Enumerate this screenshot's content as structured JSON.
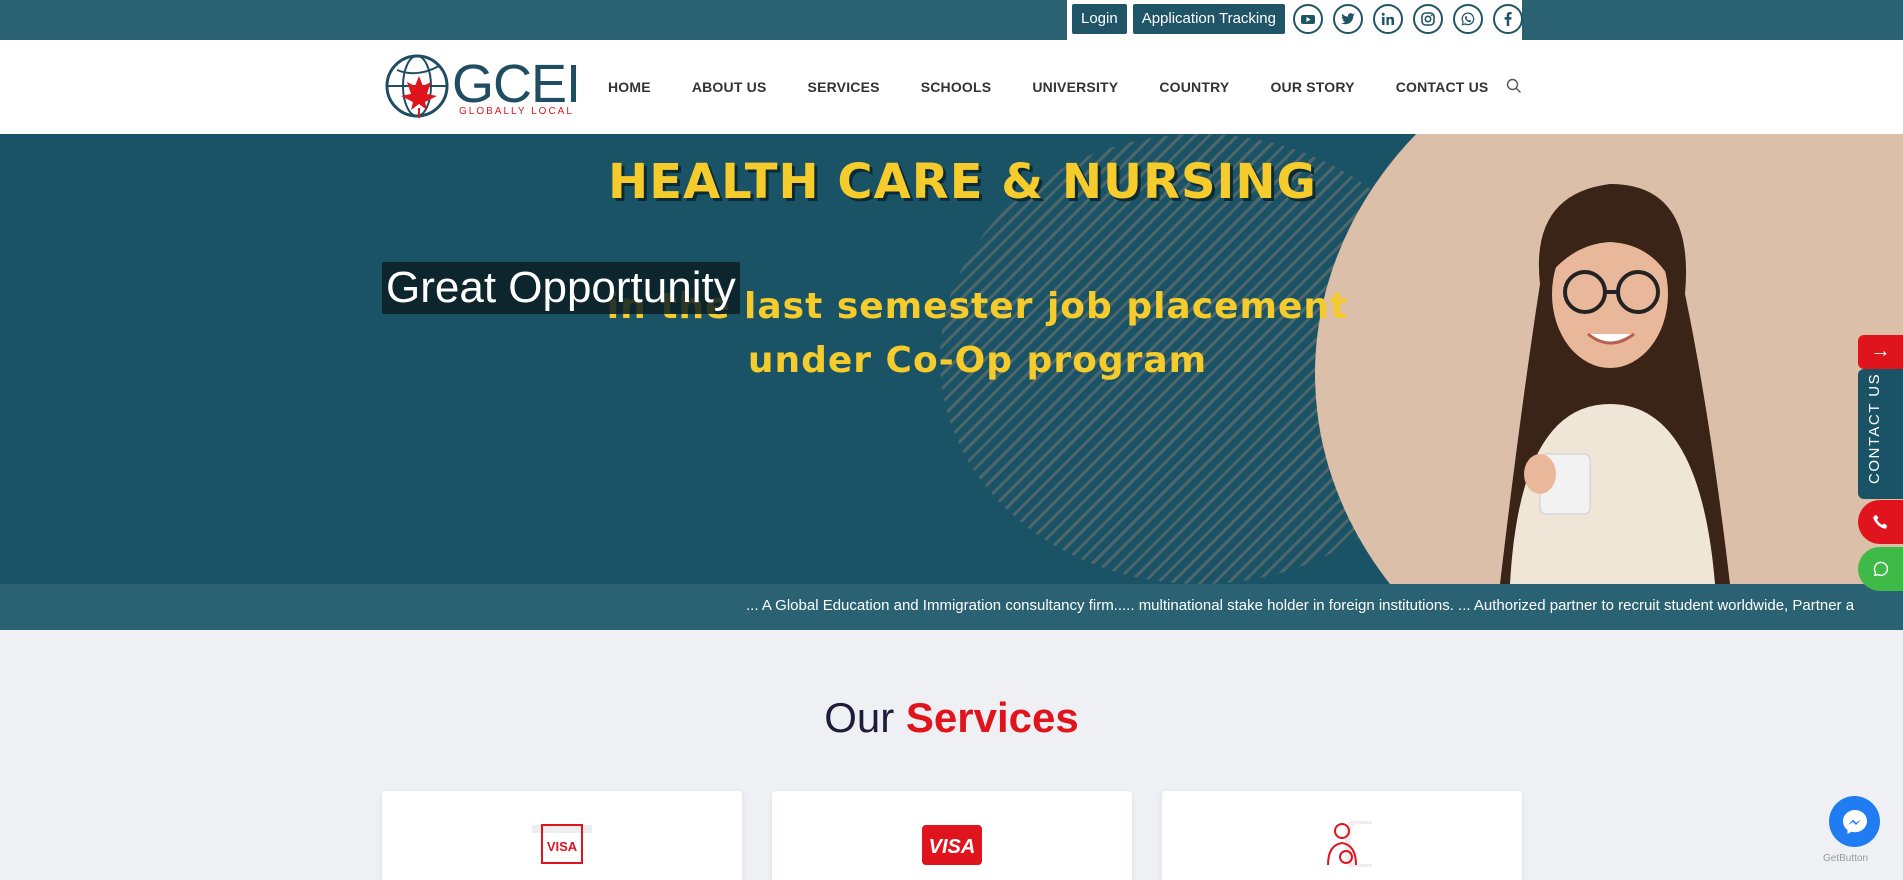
{
  "topbar": {
    "login_label": "Login",
    "tracking_label": "Application Tracking",
    "social_icons": [
      "youtube-icon",
      "twitter-icon",
      "linkedin-icon",
      "instagram-icon",
      "whatsapp-icon",
      "facebook-icon"
    ]
  },
  "logo": {
    "text": "GCEI",
    "tagline": "GLOBALLY LOCAL"
  },
  "nav": {
    "items": [
      "HOME",
      "ABOUT US",
      "SERVICES",
      "SCHOOLS",
      "UNIVERSITY",
      "COUNTRY",
      "OUR STORY",
      "CONTACT US"
    ]
  },
  "hero": {
    "title": "HEALTH CARE & NURSING",
    "subtitle_line1": "in the last semester job placement",
    "subtitle_line2": "under Co-Op program",
    "caption": "Great Opportunity"
  },
  "ticker": {
    "text": "... A Global Education and Immigration consultancy firm..... multinational stake holder in foreign institutions. ... Authorized partner to recruit student worldwide, Partner a"
  },
  "services": {
    "title_prefix": "Our",
    "title_highlight": "Services"
  },
  "floating": {
    "arrow": "→",
    "contact_label": "CONTACT US",
    "getbutton": "GetButton"
  },
  "colors": {
    "brand_dark": "#1b5366",
    "brand_topbar": "#2a6273",
    "accent_red": "#e0141c",
    "hero_yellow": "#f5cc2c",
    "whatsapp_green": "#3fba46",
    "messenger_blue": "#1f7df1"
  }
}
